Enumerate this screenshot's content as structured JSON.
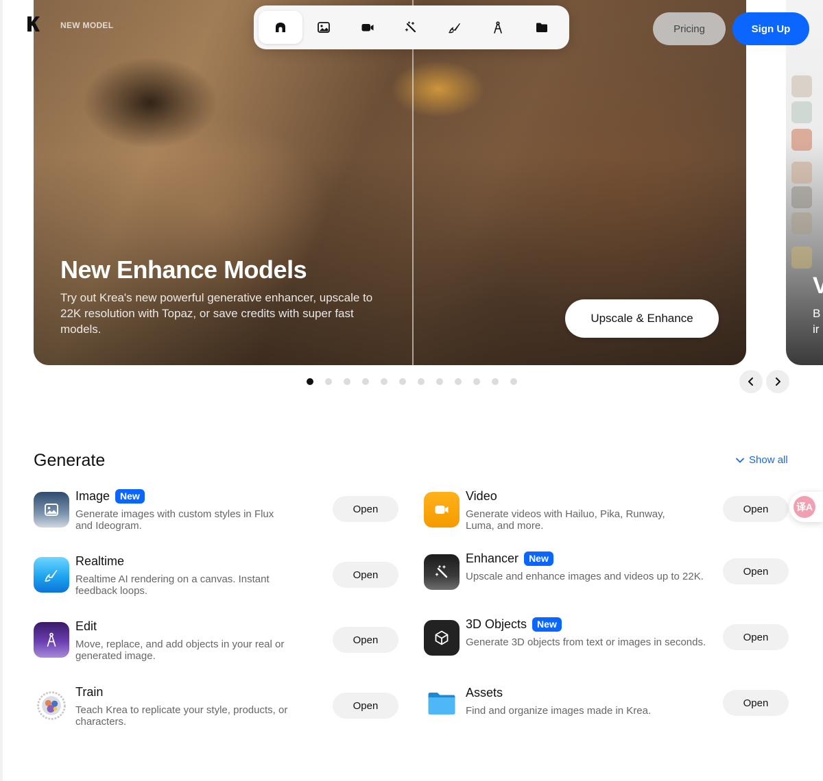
{
  "header": {
    "tag": "NEW MODEL",
    "nav_icons": [
      "home-icon",
      "image-icon",
      "video-icon",
      "enhancer-icon",
      "realtime-icon",
      "edit-icon",
      "assets-folder-icon"
    ],
    "pricing_label": "Pricing",
    "signup_label": "Sign Up"
  },
  "hero": {
    "title": "New Enhance Models",
    "description": "Try out Krea's new powerful generative enhancer, upscale to 22K resolution with Topaz, or save credits with super fast models.",
    "cta_label": "Upscale & Enhance",
    "next_slide_title": "V",
    "next_slide_text_lines": [
      "B",
      "ir"
    ]
  },
  "carousel": {
    "total_slides": 12,
    "active_index": 0
  },
  "generate": {
    "title": "Generate",
    "show_all_label": "Show all",
    "items": [
      {
        "name": "Image",
        "badge": "New",
        "description": "Generate images with custom styles in Flux and Ideogram.",
        "open_label": "Open",
        "icon": "image-icon"
      },
      {
        "name": "Video",
        "badge": "",
        "description": "Generate videos with Hailuo, Pika, Runway, Luma, and more.",
        "open_label": "Open",
        "icon": "video-icon"
      },
      {
        "name": "Realtime",
        "badge": "",
        "description": "Realtime AI rendering on a canvas. Instant feedback loops.",
        "open_label": "Open",
        "icon": "realtime-pen-icon"
      },
      {
        "name": "Enhancer",
        "badge": "New",
        "description": "Upscale and enhance images and videos up to 22K.",
        "open_label": "Open",
        "icon": "magic-wand-icon"
      },
      {
        "name": "Edit",
        "badge": "",
        "description": "Move, replace, and add objects in your real or generated image.",
        "open_label": "Open",
        "icon": "compass-icon"
      },
      {
        "name": "3D Objects",
        "badge": "New",
        "description": "Generate 3D objects from text or images in seconds.",
        "open_label": "Open",
        "icon": "cube-icon"
      },
      {
        "name": "Train",
        "badge": "",
        "description": "Teach Krea to replicate your style, products, or characters.",
        "open_label": "Open",
        "icon": "train-icon"
      },
      {
        "name": "Assets",
        "badge": "",
        "description": "Find and organize images made in Krea.",
        "open_label": "Open",
        "icon": "folder-icon"
      }
    ]
  },
  "translate_fab": {
    "label": "译A"
  }
}
